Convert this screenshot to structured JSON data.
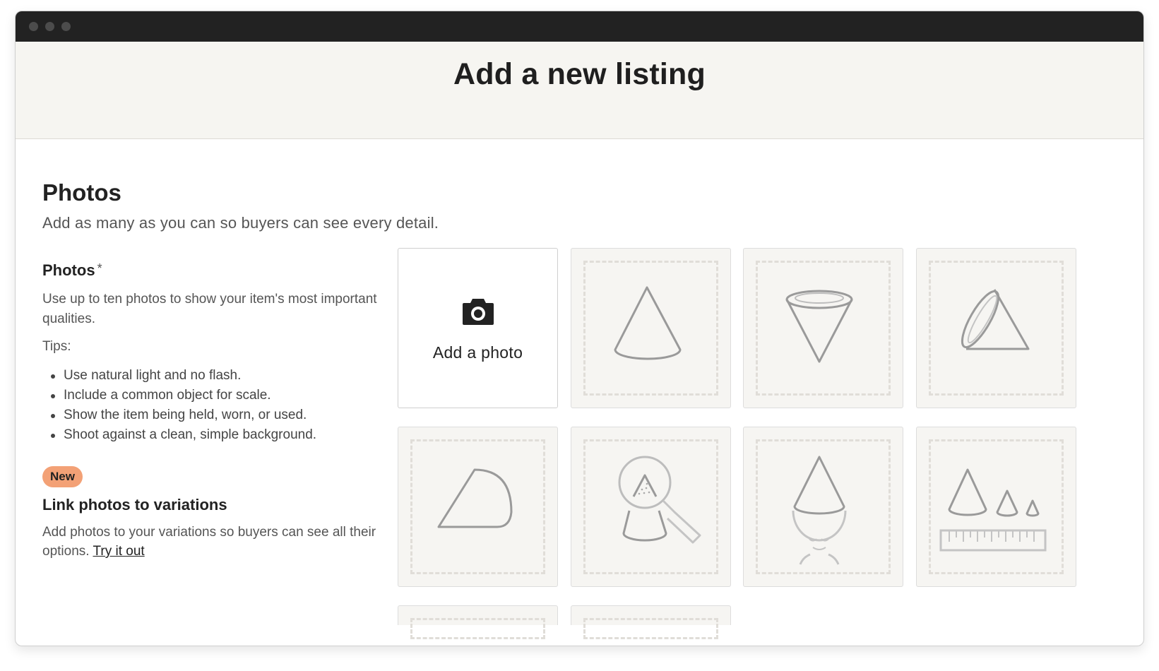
{
  "header": {
    "title": "Add a new listing"
  },
  "section": {
    "title": "Photos",
    "subtitle": "Add as many as you can so buyers can see every detail."
  },
  "photos_field": {
    "label": "Photos",
    "required_marker": "*",
    "description": "Use up to ten photos to show your item's most important qualities.",
    "tips_label": "Tips:",
    "tips": [
      "Use natural light and no flash.",
      "Include a common object for scale.",
      "Show the item being held, worn, or used.",
      "Shoot against a clean, simple background."
    ]
  },
  "variations": {
    "badge": "New",
    "title": "Link photos to variations",
    "description": "Add photos to your variations so buyers can see all their options.",
    "link_label": "Try it out"
  },
  "add_photo": {
    "label": "Add a photo",
    "icon": "camera-icon"
  },
  "placeholder_icons": [
    "cone-front-icon",
    "cone-top-icon",
    "cone-angled-icon",
    "cone-side-icon",
    "cone-detail-magnifier-icon",
    "cone-worn-icon",
    "cone-scale-ruler-icon"
  ],
  "colors": {
    "header_bg": "#f6f5f1",
    "badge_bg": "#f3a176",
    "titlebar": "#222222"
  }
}
